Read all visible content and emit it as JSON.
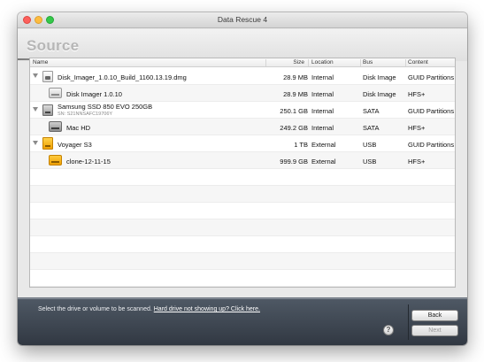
{
  "window": {
    "title": "Data Rescue 4"
  },
  "header": {
    "section_title": "Source"
  },
  "table": {
    "columns": {
      "name": "Name",
      "size": "Size",
      "location": "Location",
      "bus": "Bus",
      "content": "Content"
    },
    "rows": [
      {
        "name": "Disk_Imager_1.0.10_Build_1160.13.19.dmg",
        "size": "28.9 MB",
        "location": "Internal",
        "bus": "Disk Image",
        "content": "GUID Partitions"
      },
      {
        "name": "Disk Imager 1.0.10",
        "size": "28.9 MB",
        "location": "Internal",
        "bus": "Disk Image",
        "content": "HFS+"
      },
      {
        "name": "Samsung SSD 850 EVO 250GB",
        "serial": "SN: S21NNSAFC19706Y",
        "size": "250.1 GB",
        "location": "Internal",
        "bus": "SATA",
        "content": "GUID Partitions"
      },
      {
        "name": "Mac HD",
        "size": "249.2 GB",
        "location": "Internal",
        "bus": "SATA",
        "content": "HFS+"
      },
      {
        "name": "Voyager S3",
        "size": "1 TB",
        "location": "External",
        "bus": "USB",
        "content": "GUID Partitions"
      },
      {
        "name": "clone-12-11-15",
        "size": "999.9 GB",
        "location": "External",
        "bus": "USB",
        "content": "HFS+"
      }
    ]
  },
  "footer": {
    "instruction": "Select the drive or volume to be scanned.",
    "link": "Hard drive not showing up? Click here.",
    "help_label": "?",
    "back_label": "Back",
    "next_label": "Next"
  },
  "colors": {
    "accent": "#fdbc40",
    "footer_bg": "#3f4853",
    "external_drive": "#f6b21a"
  },
  "icons": {
    "window_controls": [
      "close-icon",
      "minimize-icon",
      "maximize-icon"
    ],
    "disk_image": "dmg-icon",
    "volume": "volume-icon",
    "internal_drive": "internal-drive-icon",
    "external_drive": "external-drive-icon",
    "help": "help-icon"
  }
}
